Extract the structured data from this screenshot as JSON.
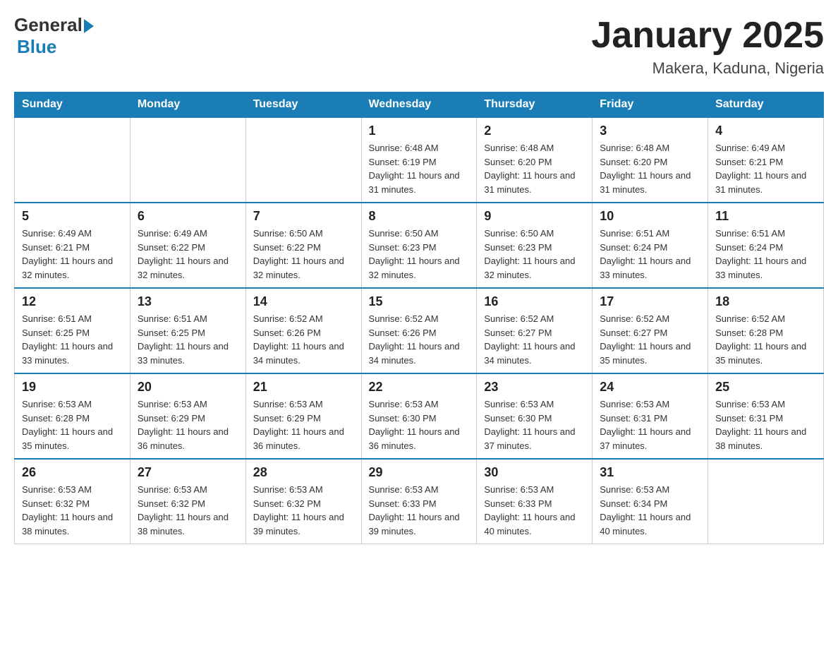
{
  "logo": {
    "general": "General",
    "blue": "Blue"
  },
  "title": "January 2025",
  "subtitle": "Makera, Kaduna, Nigeria",
  "headers": [
    "Sunday",
    "Monday",
    "Tuesday",
    "Wednesday",
    "Thursday",
    "Friday",
    "Saturday"
  ],
  "weeks": [
    [
      {
        "day": "",
        "info": ""
      },
      {
        "day": "",
        "info": ""
      },
      {
        "day": "",
        "info": ""
      },
      {
        "day": "1",
        "info": "Sunrise: 6:48 AM\nSunset: 6:19 PM\nDaylight: 11 hours and 31 minutes."
      },
      {
        "day": "2",
        "info": "Sunrise: 6:48 AM\nSunset: 6:20 PM\nDaylight: 11 hours and 31 minutes."
      },
      {
        "day": "3",
        "info": "Sunrise: 6:48 AM\nSunset: 6:20 PM\nDaylight: 11 hours and 31 minutes."
      },
      {
        "day": "4",
        "info": "Sunrise: 6:49 AM\nSunset: 6:21 PM\nDaylight: 11 hours and 31 minutes."
      }
    ],
    [
      {
        "day": "5",
        "info": "Sunrise: 6:49 AM\nSunset: 6:21 PM\nDaylight: 11 hours and 32 minutes."
      },
      {
        "day": "6",
        "info": "Sunrise: 6:49 AM\nSunset: 6:22 PM\nDaylight: 11 hours and 32 minutes."
      },
      {
        "day": "7",
        "info": "Sunrise: 6:50 AM\nSunset: 6:22 PM\nDaylight: 11 hours and 32 minutes."
      },
      {
        "day": "8",
        "info": "Sunrise: 6:50 AM\nSunset: 6:23 PM\nDaylight: 11 hours and 32 minutes."
      },
      {
        "day": "9",
        "info": "Sunrise: 6:50 AM\nSunset: 6:23 PM\nDaylight: 11 hours and 32 minutes."
      },
      {
        "day": "10",
        "info": "Sunrise: 6:51 AM\nSunset: 6:24 PM\nDaylight: 11 hours and 33 minutes."
      },
      {
        "day": "11",
        "info": "Sunrise: 6:51 AM\nSunset: 6:24 PM\nDaylight: 11 hours and 33 minutes."
      }
    ],
    [
      {
        "day": "12",
        "info": "Sunrise: 6:51 AM\nSunset: 6:25 PM\nDaylight: 11 hours and 33 minutes."
      },
      {
        "day": "13",
        "info": "Sunrise: 6:51 AM\nSunset: 6:25 PM\nDaylight: 11 hours and 33 minutes."
      },
      {
        "day": "14",
        "info": "Sunrise: 6:52 AM\nSunset: 6:26 PM\nDaylight: 11 hours and 34 minutes."
      },
      {
        "day": "15",
        "info": "Sunrise: 6:52 AM\nSunset: 6:26 PM\nDaylight: 11 hours and 34 minutes."
      },
      {
        "day": "16",
        "info": "Sunrise: 6:52 AM\nSunset: 6:27 PM\nDaylight: 11 hours and 34 minutes."
      },
      {
        "day": "17",
        "info": "Sunrise: 6:52 AM\nSunset: 6:27 PM\nDaylight: 11 hours and 35 minutes."
      },
      {
        "day": "18",
        "info": "Sunrise: 6:52 AM\nSunset: 6:28 PM\nDaylight: 11 hours and 35 minutes."
      }
    ],
    [
      {
        "day": "19",
        "info": "Sunrise: 6:53 AM\nSunset: 6:28 PM\nDaylight: 11 hours and 35 minutes."
      },
      {
        "day": "20",
        "info": "Sunrise: 6:53 AM\nSunset: 6:29 PM\nDaylight: 11 hours and 36 minutes."
      },
      {
        "day": "21",
        "info": "Sunrise: 6:53 AM\nSunset: 6:29 PM\nDaylight: 11 hours and 36 minutes."
      },
      {
        "day": "22",
        "info": "Sunrise: 6:53 AM\nSunset: 6:30 PM\nDaylight: 11 hours and 36 minutes."
      },
      {
        "day": "23",
        "info": "Sunrise: 6:53 AM\nSunset: 6:30 PM\nDaylight: 11 hours and 37 minutes."
      },
      {
        "day": "24",
        "info": "Sunrise: 6:53 AM\nSunset: 6:31 PM\nDaylight: 11 hours and 37 minutes."
      },
      {
        "day": "25",
        "info": "Sunrise: 6:53 AM\nSunset: 6:31 PM\nDaylight: 11 hours and 38 minutes."
      }
    ],
    [
      {
        "day": "26",
        "info": "Sunrise: 6:53 AM\nSunset: 6:32 PM\nDaylight: 11 hours and 38 minutes."
      },
      {
        "day": "27",
        "info": "Sunrise: 6:53 AM\nSunset: 6:32 PM\nDaylight: 11 hours and 38 minutes."
      },
      {
        "day": "28",
        "info": "Sunrise: 6:53 AM\nSunset: 6:32 PM\nDaylight: 11 hours and 39 minutes."
      },
      {
        "day": "29",
        "info": "Sunrise: 6:53 AM\nSunset: 6:33 PM\nDaylight: 11 hours and 39 minutes."
      },
      {
        "day": "30",
        "info": "Sunrise: 6:53 AM\nSunset: 6:33 PM\nDaylight: 11 hours and 40 minutes."
      },
      {
        "day": "31",
        "info": "Sunrise: 6:53 AM\nSunset: 6:34 PM\nDaylight: 11 hours and 40 minutes."
      },
      {
        "day": "",
        "info": ""
      }
    ]
  ]
}
